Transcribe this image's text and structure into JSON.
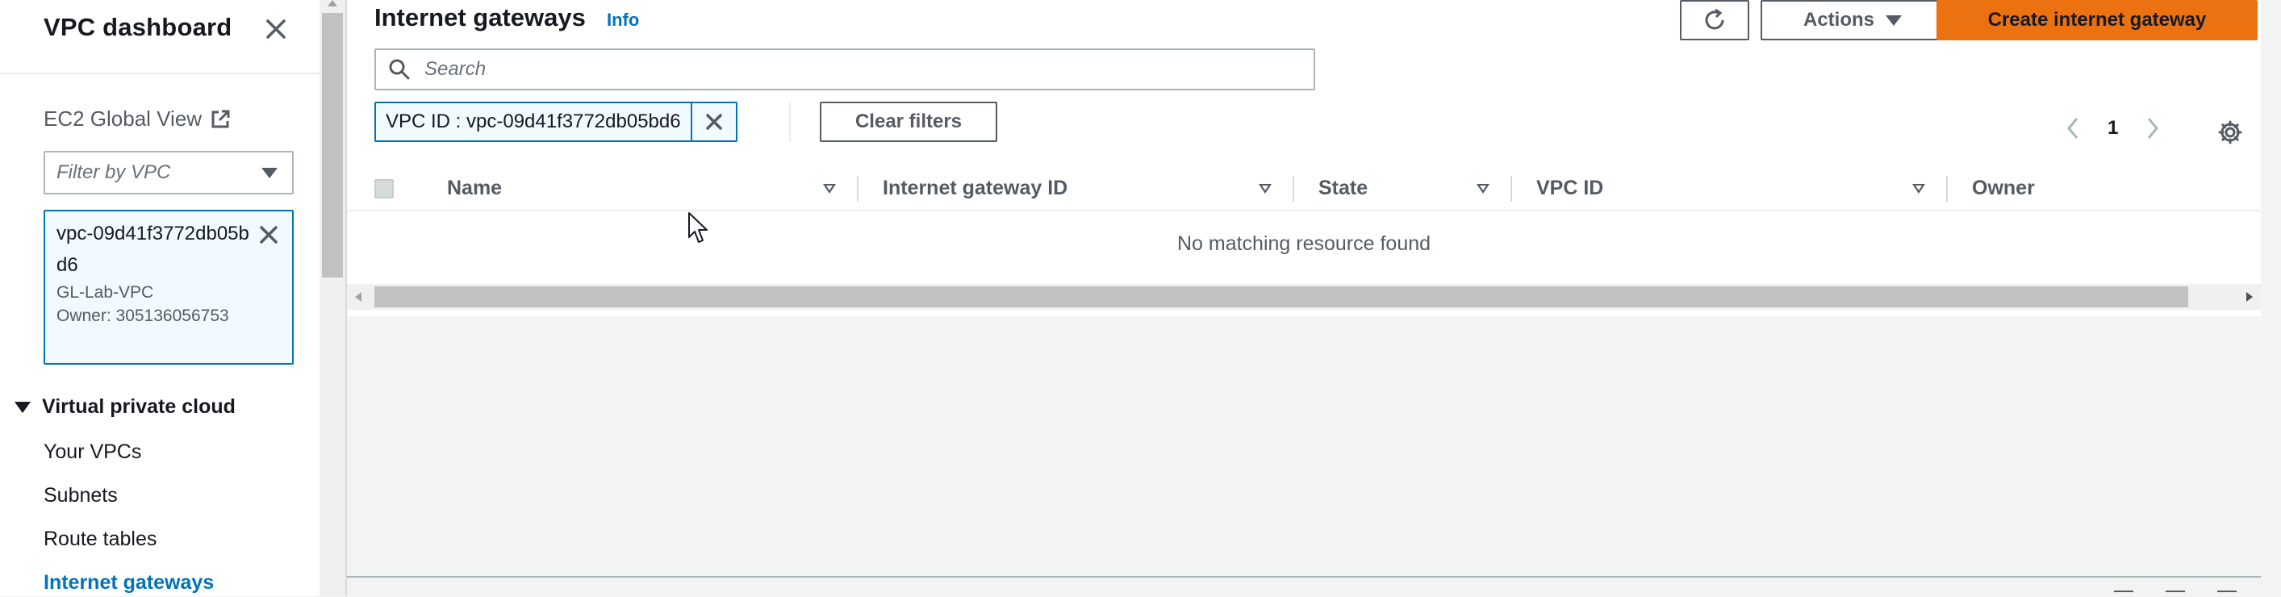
{
  "sidebar": {
    "title": "VPC dashboard",
    "ec2_global_view": "EC2 Global View",
    "vpc_filter": {
      "placeholder": "Filter by VPC"
    },
    "selected_vpc": {
      "id": "vpc-09d41f3772db05bd6",
      "name": "GL-Lab-VPC",
      "owner": "Owner: 305136056753"
    },
    "section": "Virtual private cloud",
    "items": [
      {
        "label": "Your VPCs"
      },
      {
        "label": "Subnets"
      },
      {
        "label": "Route tables"
      },
      {
        "label": "Internet gateways",
        "active": true
      }
    ]
  },
  "header": {
    "title": "Internet gateways",
    "info": "Info",
    "actions_label": "Actions",
    "create_label": "Create internet gateway"
  },
  "search": {
    "placeholder": "Search"
  },
  "filters": {
    "token": "VPC ID : vpc-09d41f3772db05bd6",
    "clear_label": "Clear filters"
  },
  "pagination": {
    "current_page": "1"
  },
  "table": {
    "columns": [
      "Name",
      "Internet gateway ID",
      "State",
      "VPC ID",
      "Owner"
    ],
    "empty_message": "No matching resource found"
  },
  "colors": {
    "primary_orange": "#ec7211",
    "link_blue": "#0073bb",
    "text_dark": "#16191f",
    "text_grey": "#545b64"
  }
}
